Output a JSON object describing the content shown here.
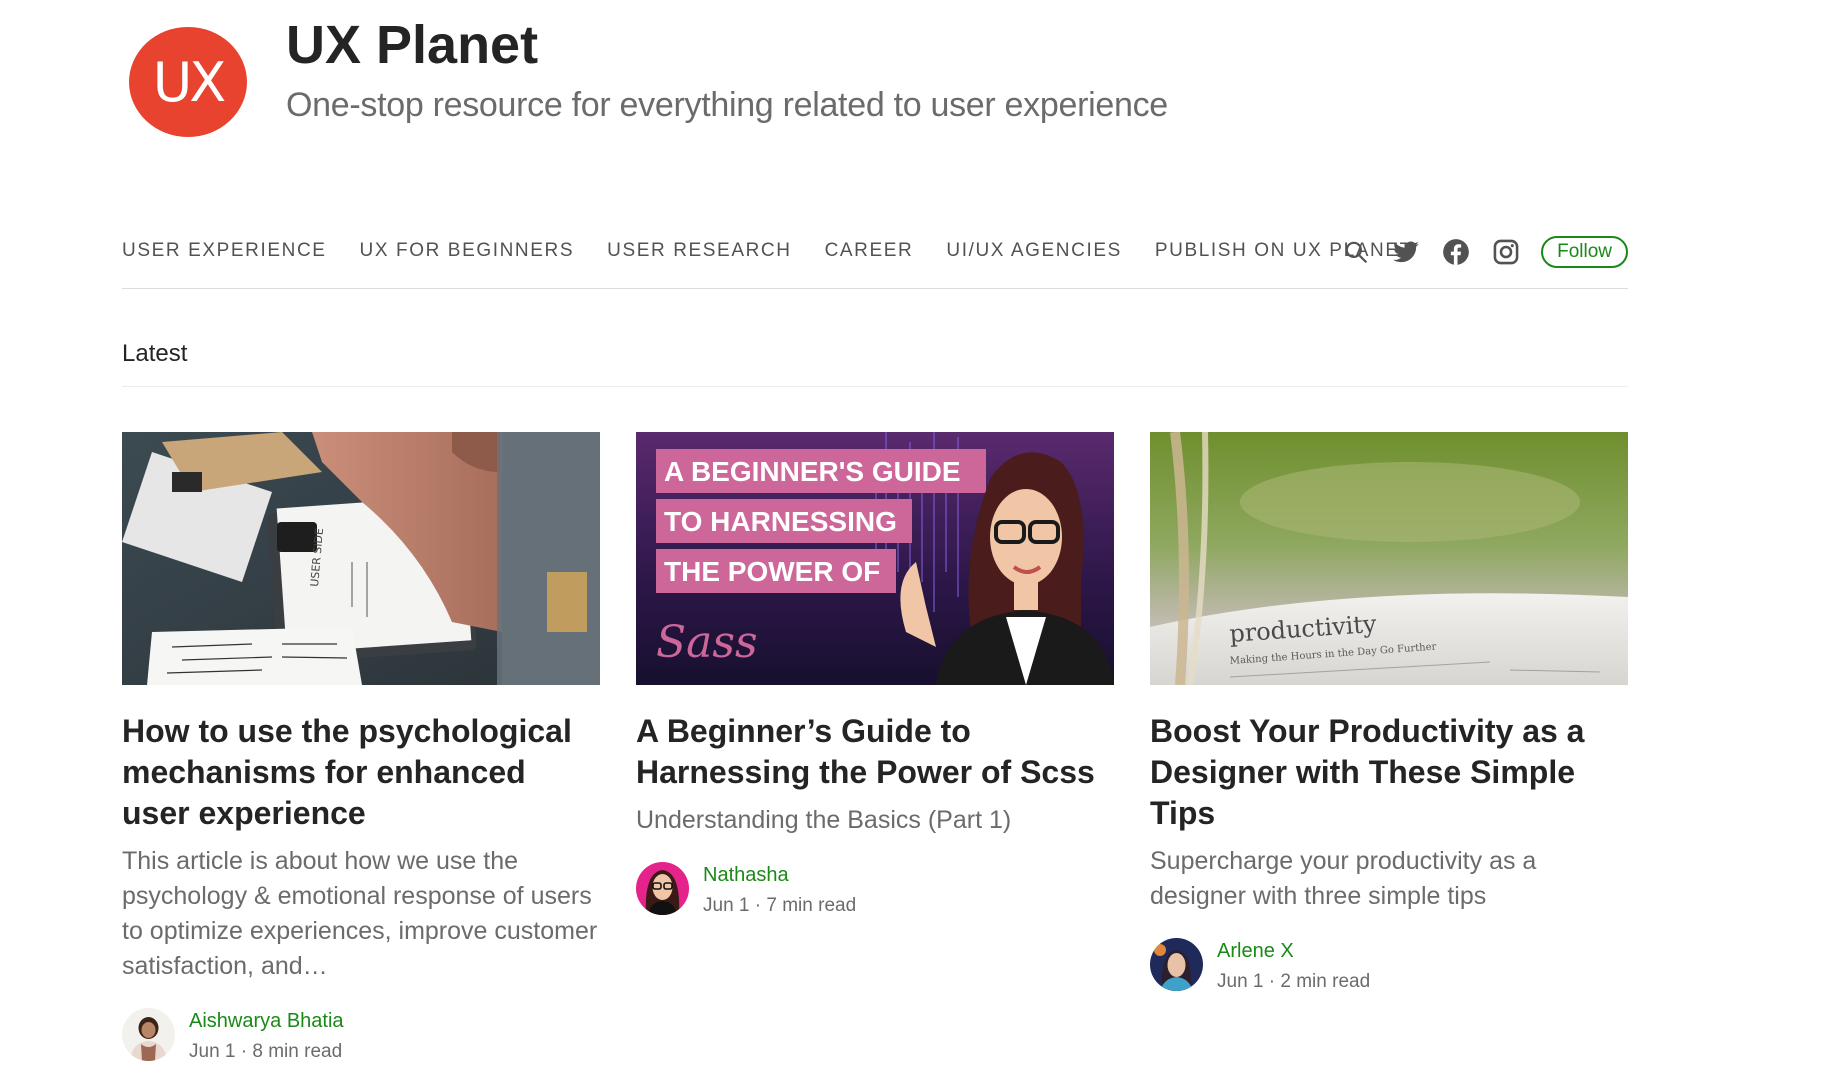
{
  "publication": {
    "logo_text": "UX",
    "title": "UX Planet",
    "tagline": "One-stop resource for everything related to user experience"
  },
  "nav": {
    "items": [
      {
        "label": "USER EXPERIENCE"
      },
      {
        "label": "UX FOR BEGINNERS"
      },
      {
        "label": "USER RESEARCH"
      },
      {
        "label": "CAREER"
      },
      {
        "label": "UI/UX AGENCIES"
      },
      {
        "label": "PUBLISH ON UX PLANET"
      }
    ],
    "icons": [
      "search-icon",
      "twitter-icon",
      "facebook-icon",
      "instagram-icon"
    ],
    "follow_label": "Follow"
  },
  "section": {
    "label": "Latest"
  },
  "articles": [
    {
      "title": "How to use the psychological mechanisms for enhanced user experience",
      "subtitle": "This article is about how we use the psychology & emotional response of users to optimize experiences, improve customer satisfaction, and…",
      "author": "Aishwarya Bhatia",
      "date": "Jun 1",
      "read_time": "8 min read",
      "thumb": {
        "paper_text": "USER SIDE"
      }
    },
    {
      "title": "A Beginner’s Guide to Harnessing the Power of Scss",
      "subtitle": "Understanding the Basics (Part 1)",
      "author": "Nathasha",
      "date": "Jun 1",
      "read_time": "7 min read",
      "thumb": {
        "banner_lines": [
          "A BEGINNER'S GUIDE",
          "TO HARNESSING",
          "THE POWER OF"
        ],
        "logo_text": "Sass"
      }
    },
    {
      "title": "Boost Your Productivity as a Designer with These Simple Tips",
      "subtitle": "Supercharge your productivity as a designer with three simple tips",
      "author": "Arlene X",
      "date": "Jun 1",
      "read_time": "2 min read",
      "thumb": {
        "book_heading": "productivity",
        "book_subheading": "Making the Hours in the Day Go Further"
      }
    }
  ],
  "colors": {
    "logo_red": "#e8432f",
    "brand_green": "#1a8917",
    "sass_pink": "#cd6799"
  }
}
